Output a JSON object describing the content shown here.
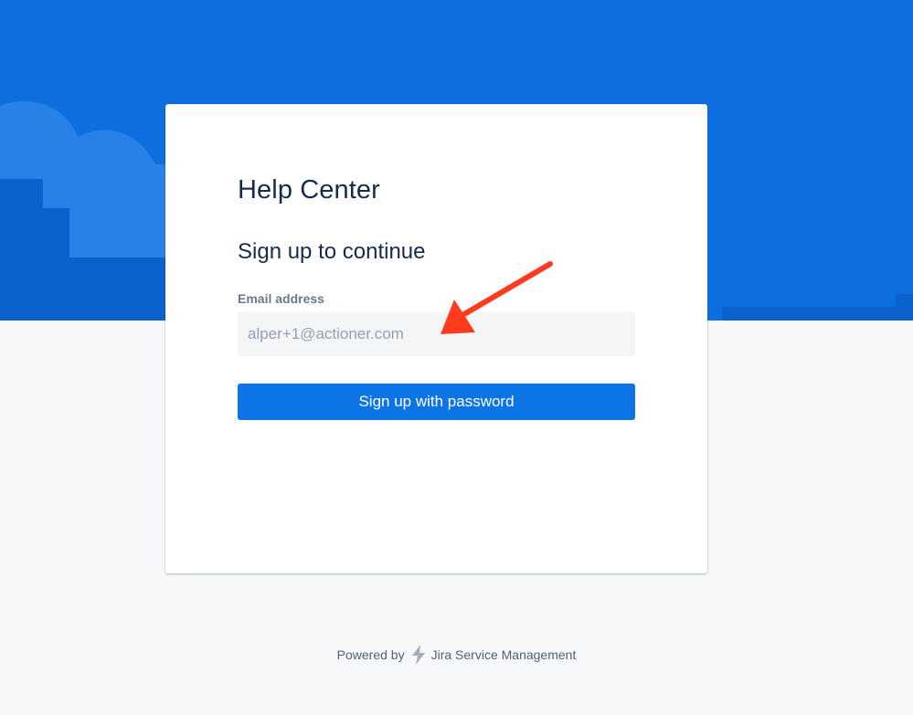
{
  "portal": {
    "title": "Help Center"
  },
  "signup_form": {
    "heading": "Sign up to continue",
    "email_label": "Email address",
    "email_placeholder": "alper+1@actioner.com",
    "email_value": "",
    "submit_label": "Sign up with password"
  },
  "footer": {
    "powered_by": "Powered by",
    "product_name": "Jira Service Management",
    "logo_icon": "lightning-bolt-icon"
  },
  "annotation": {
    "arrow_icon": "red-arrow-icon",
    "color": "#ff3b1f"
  },
  "colors": {
    "hero_background": "#0b6fe0",
    "primary_button": "#0c74e4",
    "page_background": "#f7f8fa",
    "heading_text": "#172b4d"
  }
}
